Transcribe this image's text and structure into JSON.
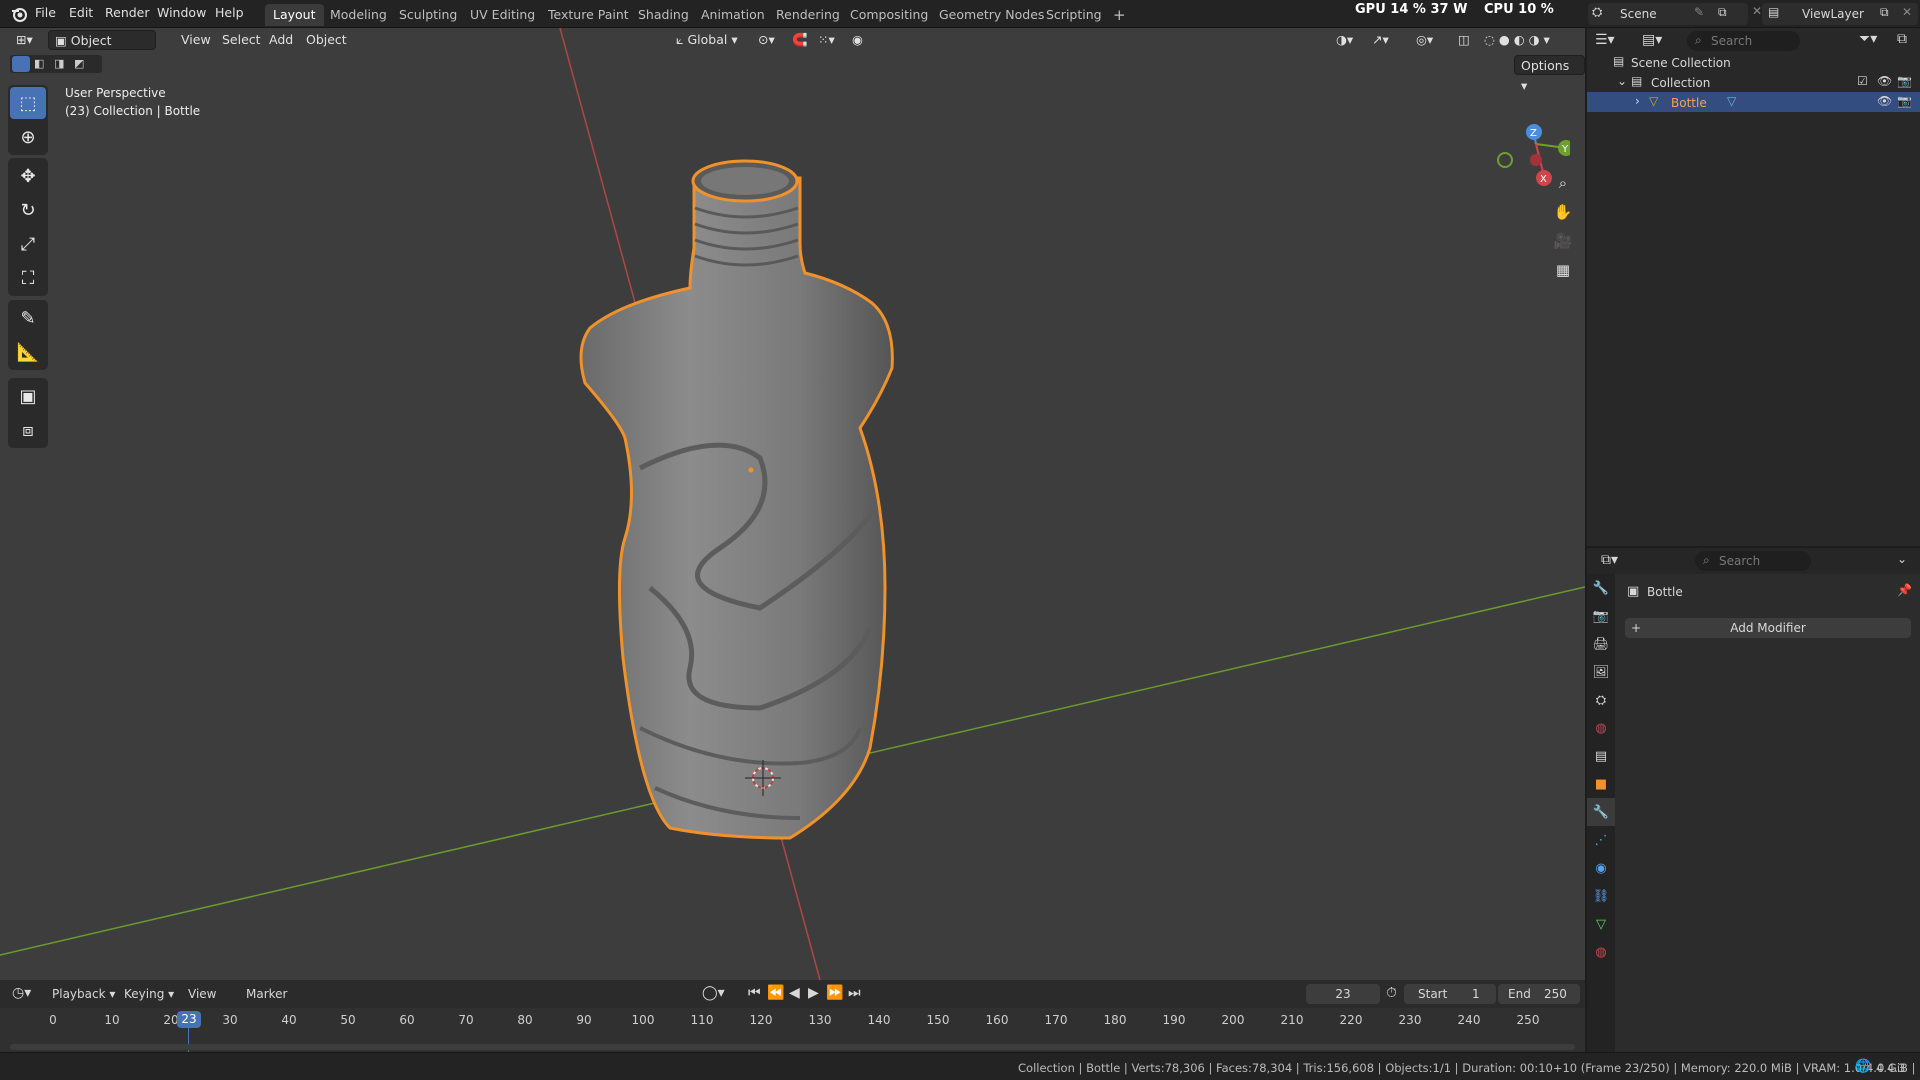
{
  "menus": [
    "File",
    "Edit",
    "Render",
    "Window",
    "Help"
  ],
  "workspaces": [
    {
      "label": "Layout",
      "active": true
    },
    {
      "label": "Modeling"
    },
    {
      "label": "Sculpting"
    },
    {
      "label": "UV Editing"
    },
    {
      "label": "Texture Paint"
    },
    {
      "label": "Shading"
    },
    {
      "label": "Animation"
    },
    {
      "label": "Rendering"
    },
    {
      "label": "Compositing"
    },
    {
      "label": "Geometry Nodes"
    },
    {
      "label": "Scripting"
    }
  ],
  "add_workspace": "+",
  "perf": {
    "gpu_label": "GPU",
    "gpu_value": "14 %",
    "gpu_watts": "37 W",
    "cpu_label": "CPU",
    "cpu_value": "10 %"
  },
  "scene": {
    "name": "Scene",
    "view_layer": "ViewLayer"
  },
  "viewport": {
    "mode": "Object Mode",
    "menus": [
      "View",
      "Select",
      "Add",
      "Object"
    ],
    "orientation": "Global",
    "options": "Options",
    "perspective": "User Perspective",
    "collection_info": "(23) Collection | Bottle",
    "axes": {
      "x": "X",
      "y": "Y",
      "z": "Z"
    },
    "colors": {
      "x_axis": "#c0413f",
      "y_axis": "#6b9a2d",
      "selection": "#f0922b",
      "accent": "#4772b3"
    }
  },
  "tools": [
    "select-box",
    "cursor",
    "move",
    "rotate",
    "scale",
    "transform",
    "annotate",
    "measure",
    "add-cube",
    "extrude"
  ],
  "outliner": {
    "search_placeholder": "Search",
    "scene_collection": "Scene Collection",
    "collection": "Collection",
    "object": "Bottle"
  },
  "properties": {
    "search_placeholder": "Search",
    "object_name": "Bottle",
    "add_modifier": "Add Modifier"
  },
  "timeline": {
    "menus": [
      "Playback",
      "Keying",
      "View",
      "Marker"
    ],
    "current_frame": "23",
    "start_label": "Start",
    "start": "1",
    "end_label": "End",
    "end": "250",
    "ticks": [
      "0",
      "10",
      "20",
      "30",
      "40",
      "50",
      "60",
      "70",
      "80",
      "90",
      "100",
      "110",
      "120",
      "130",
      "140",
      "150",
      "160",
      "170",
      "180",
      "190",
      "200",
      "210",
      "220",
      "230",
      "240",
      "250"
    ],
    "playhead_label": "23"
  },
  "status": "Collection | Bottle | Verts:78,306 | Faces:78,304 | Tris:156,608 | Objects:1/1 | Duration: 00:10+10 (Frame 23/250) | Memory: 220.0 MiB | VRAM: 1.0/4.0 GiB |",
  "version": "4.4.3"
}
